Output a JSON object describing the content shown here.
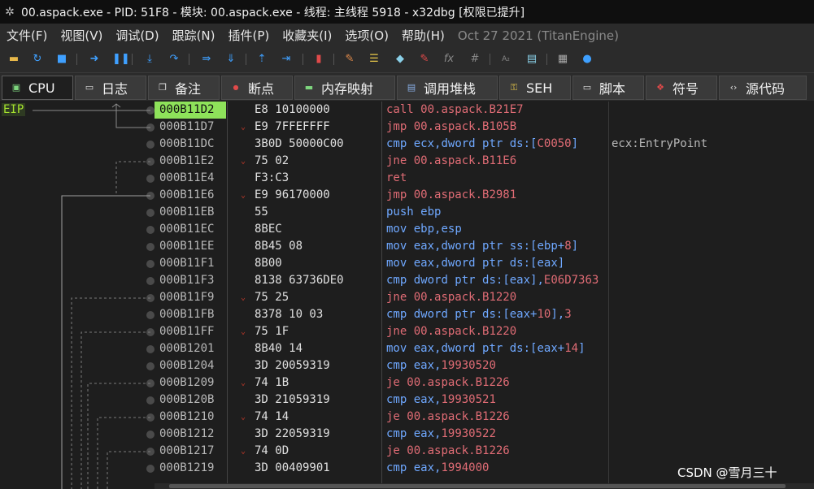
{
  "window": {
    "title": "00.aspack.exe - PID: 51F8 - 模块: 00.aspack.exe - 线程: 主线程 5918 - x32dbg [权限已提升]"
  },
  "menu": {
    "items": [
      "文件(F)",
      "视图(V)",
      "调试(D)",
      "跟踪(N)",
      "插件(P)",
      "收藏夹(I)",
      "选项(O)",
      "帮助(H)"
    ],
    "version": "Oct 27 2021 (TitanEngine)"
  },
  "toolbar": {
    "icons": [
      "open-icon",
      "restart-icon",
      "stop-icon",
      "run-icon",
      "pause-icon",
      "step-into-icon",
      "step-over-icon",
      "trace-into-icon",
      "trace-over-icon",
      "execute-till-return-icon",
      "run-to-user-code-icon",
      "scylla-icon",
      "patch-icon",
      "comment-icon",
      "label-icon",
      "bookmark-icon",
      "function-icon",
      "hash-icon",
      "strings-icon",
      "memory-icon",
      "calculator-icon",
      "globe-icon"
    ],
    "fx_label": "fx",
    "hash_label": "#"
  },
  "tabs": [
    {
      "label": "CPU",
      "icon": "cpu-icon"
    },
    {
      "label": "日志",
      "icon": "log-icon"
    },
    {
      "label": "备注",
      "icon": "notes-icon"
    },
    {
      "label": "断点",
      "icon": "breakpoint-icon"
    },
    {
      "label": "内存映射",
      "icon": "memory-map-icon"
    },
    {
      "label": "调用堆栈",
      "icon": "call-stack-icon"
    },
    {
      "label": "SEH",
      "icon": "seh-icon"
    },
    {
      "label": "脚本",
      "icon": "script-icon"
    },
    {
      "label": "符号",
      "icon": "symbol-icon"
    },
    {
      "label": "源代码",
      "icon": "source-icon"
    }
  ],
  "cpu": {
    "eip_label": "EIP",
    "rows": [
      {
        "addr": "000B11D2",
        "mark": "",
        "bytes": "E8 10100000",
        "mn": "call",
        "op": [
          [
            "num",
            "00.aspack.B21E7"
          ]
        ],
        "comment": "",
        "current": true
      },
      {
        "addr": "000B11D7",
        "mark": "⌄",
        "bytes": "E9 7FFEFFFF",
        "mn": "jmp",
        "op": [
          [
            "num",
            "00.aspack.B105B"
          ]
        ],
        "comment": ""
      },
      {
        "addr": "000B11DC",
        "mark": "",
        "bytes": "3B0D 50000C00",
        "mn": "cmp",
        "op": [
          [
            "reg",
            "ecx"
          ],
          [
            "txt",
            ",dword ptr "
          ],
          [
            "seg",
            "ds"
          ],
          [
            "txt",
            ":["
          ],
          [
            "num",
            "C0050"
          ],
          [
            "txt",
            "]"
          ]
        ],
        "comment": "ecx:EntryPoint"
      },
      {
        "addr": "000B11E2",
        "mark": "⌄",
        "bytes": "75 02",
        "mn": "jne",
        "op": [
          [
            "num",
            "00.aspack.B11E6"
          ]
        ],
        "comment": ""
      },
      {
        "addr": "000B11E4",
        "mark": "",
        "bytes": "F3:C3",
        "mn": "ret",
        "op": [],
        "comment": ""
      },
      {
        "addr": "000B11E6",
        "mark": "⌄",
        "bytes": "E9 96170000",
        "mn": "jmp",
        "op": [
          [
            "num",
            "00.aspack.B2981"
          ]
        ],
        "comment": ""
      },
      {
        "addr": "000B11EB",
        "mark": "",
        "bytes": "55",
        "mn": "push",
        "op": [
          [
            "reg",
            "ebp"
          ]
        ],
        "comment": ""
      },
      {
        "addr": "000B11EC",
        "mark": "",
        "bytes": "8BEC",
        "mn": "mov",
        "op": [
          [
            "reg",
            "ebp"
          ],
          [
            "txt",
            ","
          ],
          [
            "reg",
            "esp"
          ]
        ],
        "comment": ""
      },
      {
        "addr": "000B11EE",
        "mark": "",
        "bytes": "8B45 08",
        "mn": "mov",
        "op": [
          [
            "reg",
            "eax"
          ],
          [
            "txt",
            ",dword ptr "
          ],
          [
            "seg",
            "ss"
          ],
          [
            "txt",
            ":["
          ],
          [
            "reg",
            "ebp"
          ],
          [
            "txt",
            "+"
          ],
          [
            "num",
            "8"
          ],
          [
            "txt",
            "]"
          ]
        ],
        "comment": ""
      },
      {
        "addr": "000B11F1",
        "mark": "",
        "bytes": "8B00",
        "mn": "mov",
        "op": [
          [
            "reg",
            "eax"
          ],
          [
            "txt",
            ",dword ptr "
          ],
          [
            "seg",
            "ds"
          ],
          [
            "txt",
            ":["
          ],
          [
            "reg",
            "eax"
          ],
          [
            "txt",
            "]"
          ]
        ],
        "comment": ""
      },
      {
        "addr": "000B11F3",
        "mark": "",
        "bytes": "8138 63736DE0",
        "mn": "cmp",
        "op": [
          [
            "txt",
            "dword ptr "
          ],
          [
            "seg",
            "ds"
          ],
          [
            "txt",
            ":["
          ],
          [
            "reg",
            "eax"
          ],
          [
            "txt",
            "],"
          ],
          [
            "num",
            "E06D7363"
          ]
        ],
        "comment": ""
      },
      {
        "addr": "000B11F9",
        "mark": "⌄",
        "bytes": "75 25",
        "mn": "jne",
        "op": [
          [
            "num",
            "00.aspack.B1220"
          ]
        ],
        "comment": ""
      },
      {
        "addr": "000B11FB",
        "mark": "",
        "bytes": "8378 10 03",
        "mn": "cmp",
        "op": [
          [
            "txt",
            "dword ptr "
          ],
          [
            "seg",
            "ds"
          ],
          [
            "txt",
            ":["
          ],
          [
            "reg",
            "eax"
          ],
          [
            "txt",
            "+"
          ],
          [
            "num",
            "10"
          ],
          [
            "txt",
            "],"
          ],
          [
            "num",
            "3"
          ]
        ],
        "comment": ""
      },
      {
        "addr": "000B11FF",
        "mark": "⌄",
        "bytes": "75 1F",
        "mn": "jne",
        "op": [
          [
            "num",
            "00.aspack.B1220"
          ]
        ],
        "comment": ""
      },
      {
        "addr": "000B1201",
        "mark": "",
        "bytes": "8B40 14",
        "mn": "mov",
        "op": [
          [
            "reg",
            "eax"
          ],
          [
            "txt",
            ",dword ptr "
          ],
          [
            "seg",
            "ds"
          ],
          [
            "txt",
            ":["
          ],
          [
            "reg",
            "eax"
          ],
          [
            "txt",
            "+"
          ],
          [
            "num",
            "14"
          ],
          [
            "txt",
            "]"
          ]
        ],
        "comment": ""
      },
      {
        "addr": "000B1204",
        "mark": "",
        "bytes": "3D 20059319",
        "mn": "cmp",
        "op": [
          [
            "reg",
            "eax"
          ],
          [
            "txt",
            ","
          ],
          [
            "num",
            "19930520"
          ]
        ],
        "comment": ""
      },
      {
        "addr": "000B1209",
        "mark": "⌄",
        "bytes": "74 1B",
        "mn": "je",
        "op": [
          [
            "num",
            "00.aspack.B1226"
          ]
        ],
        "comment": ""
      },
      {
        "addr": "000B120B",
        "mark": "",
        "bytes": "3D 21059319",
        "mn": "cmp",
        "op": [
          [
            "reg",
            "eax"
          ],
          [
            "txt",
            ","
          ],
          [
            "num",
            "19930521"
          ]
        ],
        "comment": ""
      },
      {
        "addr": "000B1210",
        "mark": "⌄",
        "bytes": "74 14",
        "mn": "je",
        "op": [
          [
            "num",
            "00.aspack.B1226"
          ]
        ],
        "comment": ""
      },
      {
        "addr": "000B1212",
        "mark": "",
        "bytes": "3D 22059319",
        "mn": "cmp",
        "op": [
          [
            "reg",
            "eax"
          ],
          [
            "txt",
            ","
          ],
          [
            "num",
            "19930522"
          ]
        ],
        "comment": ""
      },
      {
        "addr": "000B1217",
        "mark": "⌄",
        "bytes": "74 0D",
        "mn": "je",
        "op": [
          [
            "num",
            "00.aspack.B1226"
          ]
        ],
        "comment": ""
      },
      {
        "addr": "000B1219",
        "mark": "",
        "bytes": "3D 00409901",
        "mn": "cmp",
        "op": [
          [
            "reg",
            "eax"
          ],
          [
            "txt",
            ","
          ],
          [
            "num",
            "1994000"
          ]
        ],
        "comment": ""
      }
    ]
  },
  "watermark": "CSDN @雪月三十",
  "colors": {
    "eip_highlight": "#8ee25a",
    "jump_keyword": "#e06c75",
    "normal_keyword": "#6fa8ff"
  }
}
